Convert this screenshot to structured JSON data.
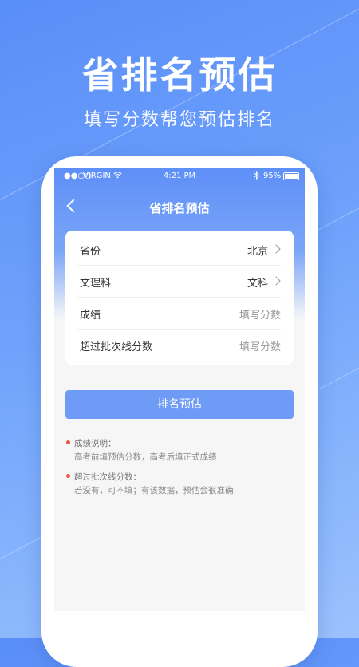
{
  "promo": {
    "title": "省排名预估",
    "subtitle": "填写分数帮您预估排名"
  },
  "status_bar": {
    "signal": "●●○○",
    "carrier": "VIRGIN",
    "wifi_icon": "wifi-icon",
    "time": "4:21 PM",
    "bluetooth_icon": "bluetooth-icon",
    "battery": "95%",
    "battery_level": 0.95
  },
  "navbar": {
    "title": "省排名预估",
    "back_icon": "back-chevron-icon"
  },
  "form": {
    "rows": [
      {
        "label": "省份",
        "value": "北京",
        "placeholder": ""
      },
      {
        "label": "文理科",
        "value": "文科",
        "placeholder": ""
      },
      {
        "label": "成绩",
        "value": "",
        "placeholder": "填写分数"
      },
      {
        "label": "超过批次线分数",
        "value": "",
        "placeholder": "填写分数"
      }
    ]
  },
  "submit_label": "排名预估",
  "notes": [
    {
      "head": "成绩说明：",
      "body": "高考前填预估分数，高考后填正式成绩"
    },
    {
      "head": "超过批次线分数：",
      "body": "若没有，可不填；有该数据，预估会很准确"
    }
  ],
  "colors": {
    "accent": "#6e9bf6",
    "background_top": "#5a8ef8",
    "note_dot": "#f0553f"
  }
}
